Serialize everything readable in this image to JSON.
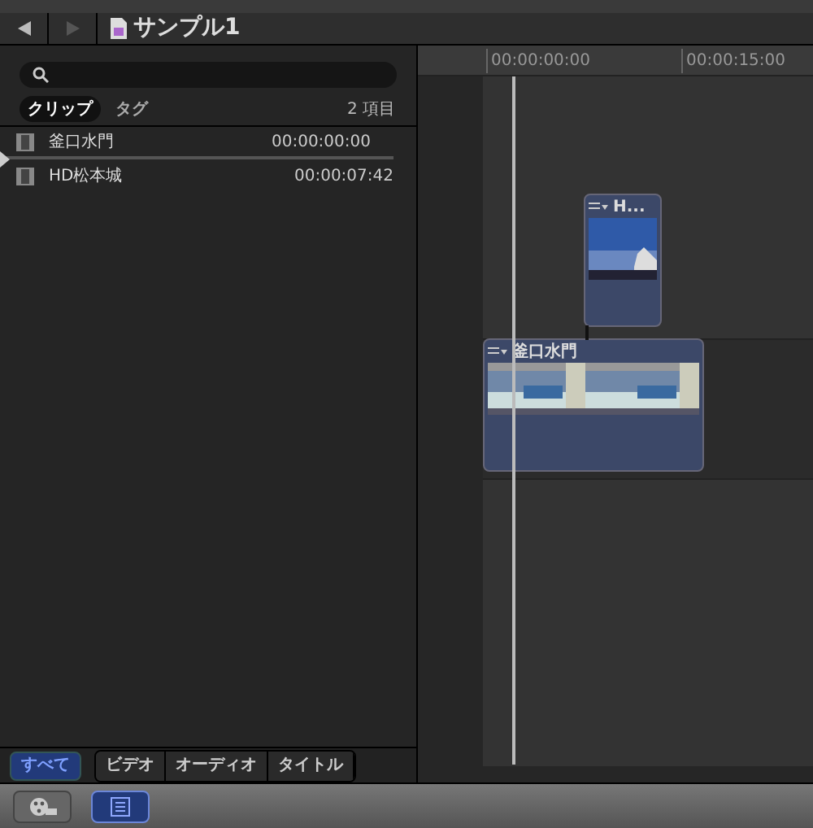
{
  "header": {
    "title": "サンプル1"
  },
  "browser": {
    "filters": [
      {
        "label": "クリップ",
        "selected": true
      },
      {
        "label": "タグ",
        "selected": false
      }
    ],
    "count": "2 項目",
    "clips": [
      {
        "name": "釜口水門",
        "time": "00:00:00:00"
      },
      {
        "name": "HD松本城",
        "time": "00:00:07:42"
      }
    ],
    "types": [
      {
        "label": "すべて",
        "selected": true
      },
      {
        "label": "ビデオ",
        "selected": false
      },
      {
        "label": "オーディオ",
        "selected": false
      },
      {
        "label": "タイトル",
        "selected": false
      }
    ]
  },
  "timeline": {
    "ruler": [
      "00:00:00:00",
      "00:00:15:00"
    ],
    "clips": [
      {
        "kind": "connected",
        "title": "H..."
      },
      {
        "kind": "primary",
        "title": "釜口水門"
      }
    ]
  },
  "toolbar": [
    {
      "kind": "media",
      "selected": false
    },
    {
      "kind": "list",
      "selected": true
    }
  ]
}
